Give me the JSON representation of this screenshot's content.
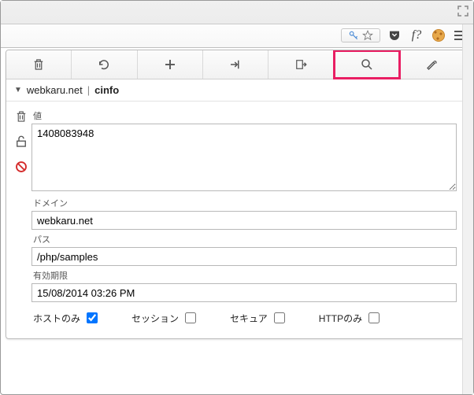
{
  "cookie": {
    "site": "webkaru.net",
    "name": "cinfo",
    "labels": {
      "value": "値",
      "domain": "ドメイン",
      "path": "パス",
      "expires": "有効期限",
      "host_only": "ホストのみ",
      "session": "セッション",
      "secure": "セキュア",
      "http_only": "HTTPのみ"
    },
    "value": "1408083948",
    "domain": "webkaru.net",
    "path": "/php/samples",
    "expires": "15/08/2014 03:26 PM",
    "flags": {
      "host_only": true,
      "session": false,
      "secure": false,
      "http_only": false
    }
  },
  "ext_icons": {
    "fq": "f?"
  },
  "sep": " | "
}
